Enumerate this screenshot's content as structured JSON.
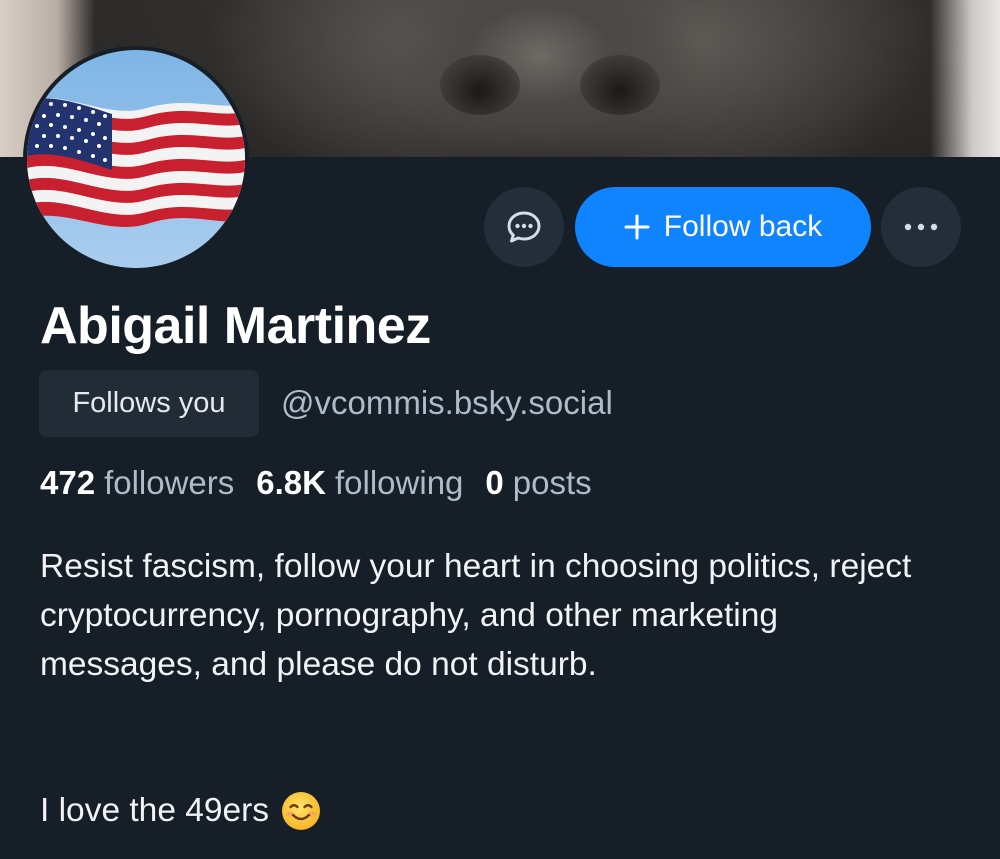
{
  "profile": {
    "display_name": "Abigail Martinez",
    "follows_you_label": "Follows you",
    "handle": "@vcommis.bsky.social",
    "avatar_icon": "american-flag-avatar",
    "banner_image": "dog-snout-closeup-banner"
  },
  "actions": {
    "message_icon": "chat-bubble-icon",
    "follow_label": "Follow back",
    "follow_icon": "plus-icon",
    "more_icon": "ellipsis-icon"
  },
  "stats": {
    "followers_count": "472",
    "followers_label": "followers",
    "following_count": "6.8K",
    "following_label": "following",
    "posts_count": "0",
    "posts_label": "posts"
  },
  "bio": {
    "paragraph": "Resist fascism, follow your heart in choosing politics, reject cryptocurrency, pornography, and other marketing messages, and please do not disturb.",
    "line2": "I love the 49ers",
    "line2_emoji_icon": "smiling-face-icon"
  },
  "colors": {
    "background": "#161e27",
    "accent": "#1083fe",
    "secondary_button": "#232e3a",
    "muted_text": "#aebbc9"
  }
}
